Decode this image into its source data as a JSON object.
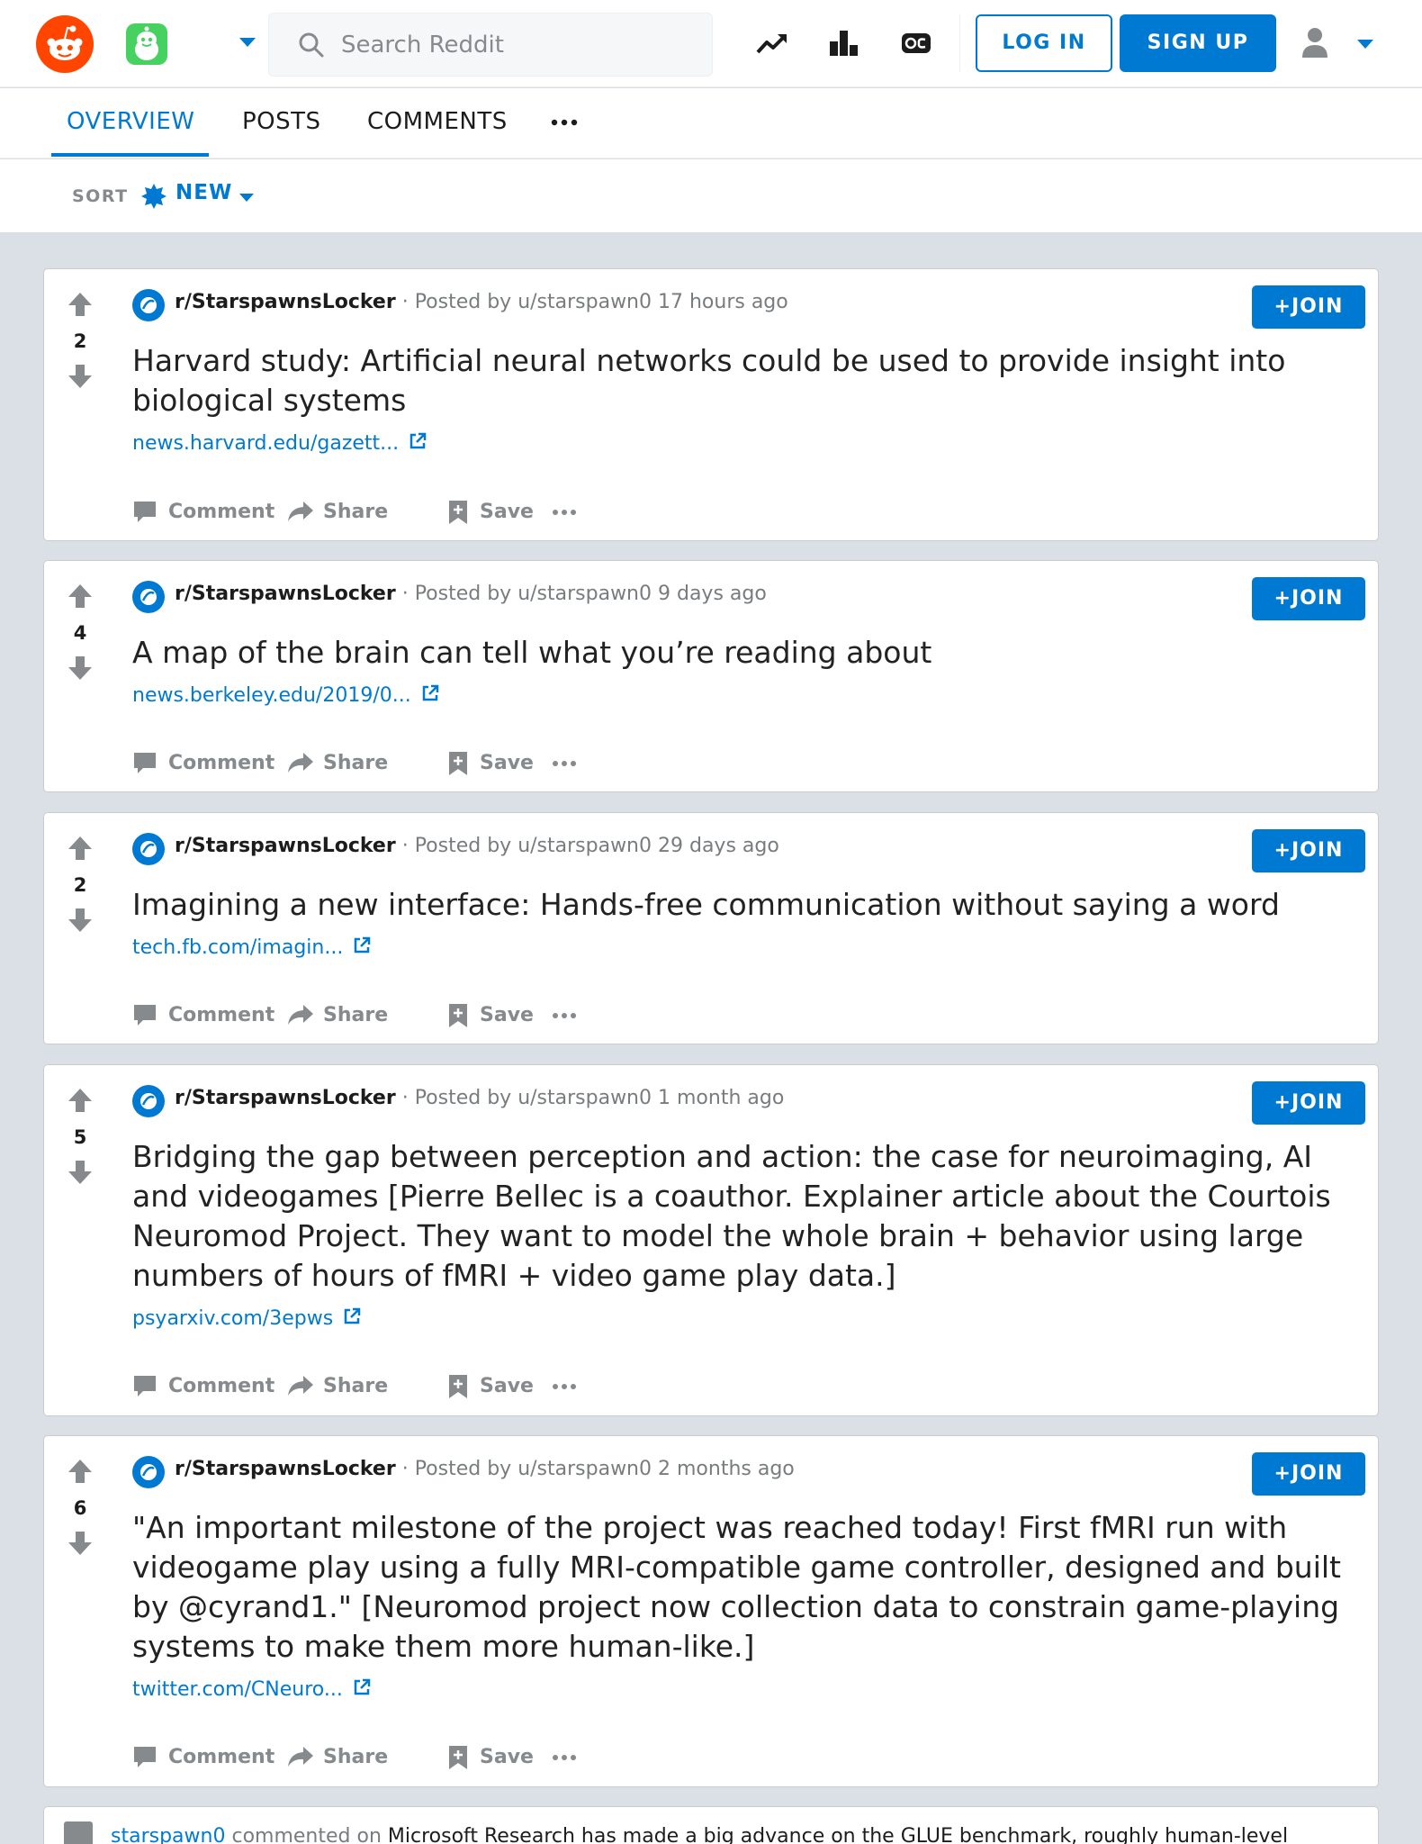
{
  "header": {
    "search_placeholder": "Search Reddit",
    "login_label": "LOG IN",
    "signup_label": "SIGN UP",
    "icons": [
      "reddit-logo-icon",
      "snoo-avatar-icon",
      "popular-icon",
      "leaderboard-icon",
      "oc-icon",
      "user-icon"
    ]
  },
  "tabs": {
    "items": [
      "OVERVIEW",
      "POSTS",
      "COMMENTS"
    ],
    "active": "OVERVIEW"
  },
  "sort": {
    "label": "SORT",
    "value": "NEW"
  },
  "posts": [
    {
      "votes": "2",
      "subreddit": "r/StarspawnsLocker",
      "posted_by": "Posted by u/starspawn0 17 hours ago",
      "join_label": "JOIN",
      "title": "Harvard study: Artificial neural networks could be used to provide insight into biological systems",
      "link": "news.harvard.edu/gazett...",
      "actions": [
        "Comment",
        "Share",
        "Save"
      ]
    },
    {
      "votes": "4",
      "subreddit": "r/StarspawnsLocker",
      "posted_by": "Posted by u/starspawn0 9 days ago",
      "join_label": "JOIN",
      "title": "A map of the brain can tell what you’re reading about",
      "link": "news.berkeley.edu/2019/0...",
      "actions": [
        "Comment",
        "Share",
        "Save"
      ]
    },
    {
      "votes": "2",
      "subreddit": "r/StarspawnsLocker",
      "posted_by": "Posted by u/starspawn0 29 days ago",
      "join_label": "JOIN",
      "title": "Imagining a new interface: Hands-free communication without saying a word",
      "link": "tech.fb.com/imagin...",
      "actions": [
        "Comment",
        "Share",
        "Save"
      ]
    },
    {
      "votes": "5",
      "subreddit": "r/StarspawnsLocker",
      "posted_by": "Posted by u/starspawn0 1 month ago",
      "join_label": "JOIN",
      "title": "Bridging the gap between perception and action: the case for neuroimaging, AI and videogames [Pierre Bellec is a coauthor. Explainer article about the Courtois Neuromod Project. They want to model the whole brain + behavior using large numbers of hours of fMRI + video game play data.]",
      "link": "psyarxiv.com/3epws",
      "actions": [
        "Comment",
        "Share",
        "Save"
      ]
    },
    {
      "votes": "6",
      "subreddit": "r/StarspawnsLocker",
      "posted_by": "Posted by u/starspawn0 2 months ago",
      "join_label": "JOIN",
      "title": "\"An important milestone of the project was reached today! First fMRI run with videogame play using a fully MRI-compatible game controller, designed and built by @cyrand1.\" [Neuromod project now collection data to constrain game-playing systems to make them more human-like.]",
      "link": "twitter.com/CNeuro...",
      "actions": [
        "Comment",
        "Share",
        "Save"
      ]
    }
  ],
  "comment_teaser": {
    "user": "starspawn0",
    "verb": "commented on",
    "title": "Microsoft Research has made a big advance on the GLUE benchmark, roughly human-level"
  },
  "colors": {
    "accent": "#0079d3",
    "reddit_orange": "#ff4500",
    "background": "#dae0e6"
  }
}
